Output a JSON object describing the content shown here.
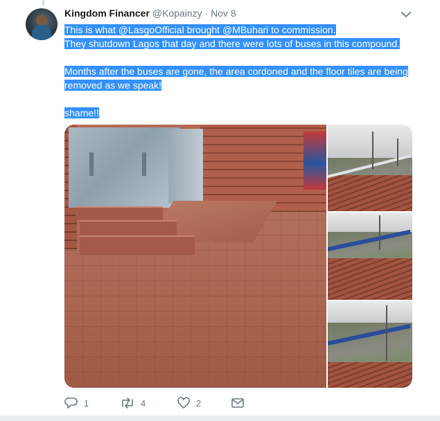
{
  "tweet": {
    "author_name": "Kingdom Financer",
    "handle": "@Kopainzy",
    "separator": "·",
    "date": "Nov 8",
    "text_lines": [
      "This is what @LasgoOfficial brought @MBuhari to commission.",
      "They shutdown Lagos that day and there were lots of buses in this compound.",
      "",
      "Months after the buses are gone, the area cordoned and the floor tiles are being",
      "removed as we speak!",
      "",
      "shame!!"
    ]
  },
  "media": {
    "images": [
      {
        "name": "main-photo"
      },
      {
        "name": "thumb-1"
      },
      {
        "name": "thumb-2"
      },
      {
        "name": "thumb-3"
      }
    ]
  },
  "actions": {
    "reply_count": "1",
    "retweet_count": "4",
    "like_count": "2",
    "icons": [
      "reply-icon",
      "retweet-icon",
      "like-icon",
      "message-icon"
    ]
  },
  "colors": {
    "selection": "#3390ff",
    "muted": "#657786",
    "text": "#14171a"
  }
}
